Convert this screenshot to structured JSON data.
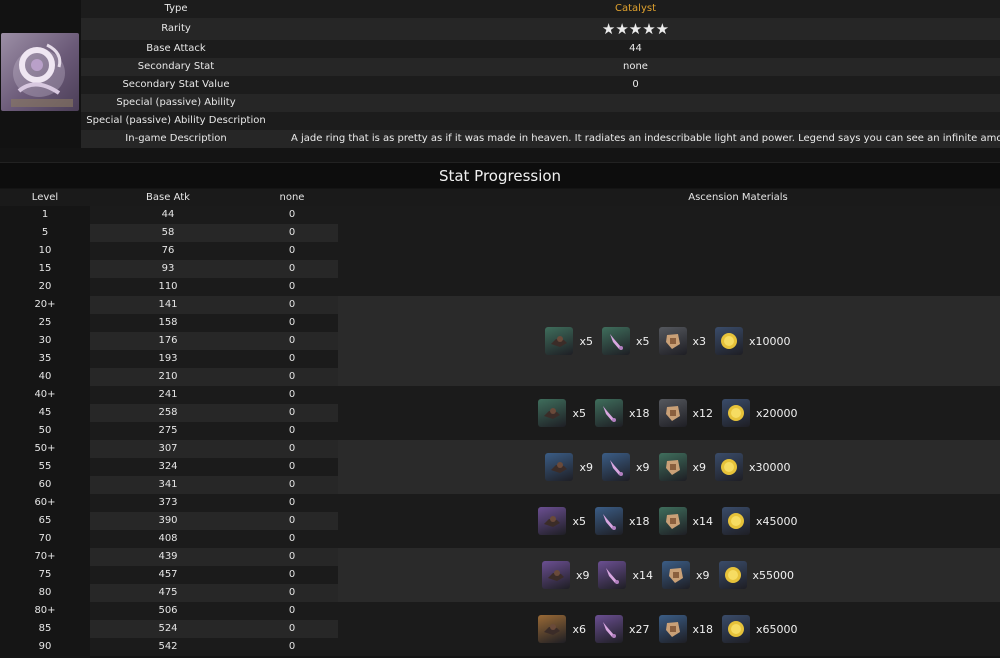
{
  "weapon": {
    "rows": [
      {
        "label": "Type",
        "value": "Catalyst"
      },
      {
        "label": "Rarity",
        "value": "★★★★★"
      },
      {
        "label": "Base Attack",
        "value": "44"
      },
      {
        "label": "Secondary Stat",
        "value": "none"
      },
      {
        "label": "Secondary Stat Value",
        "value": "0"
      },
      {
        "label": "Special (passive) Ability",
        "value": ""
      },
      {
        "label": "Special (passive) Ability Description",
        "value": ""
      },
      {
        "label": "In-game Description",
        "value": "A jade ring that is as pretty as if it was made in heaven. It radiates an indescribable light and power. Legend says you can see an infinite amou"
      }
    ]
  },
  "progression": {
    "title": "Stat Progression",
    "headers": {
      "level": "Level",
      "atk": "Base Atk",
      "sec": "none",
      "mats": "Ascension Materials"
    },
    "rows": [
      {
        "level": "1",
        "atk": "44",
        "sec": "0"
      },
      {
        "level": "5",
        "atk": "58",
        "sec": "0"
      },
      {
        "level": "10",
        "atk": "76",
        "sec": "0"
      },
      {
        "level": "15",
        "atk": "93",
        "sec": "0"
      },
      {
        "level": "20",
        "atk": "110",
        "sec": "0"
      },
      {
        "level": "20+",
        "atk": "141",
        "sec": "0"
      },
      {
        "level": "25",
        "atk": "158",
        "sec": "0"
      },
      {
        "level": "30",
        "atk": "176",
        "sec": "0"
      },
      {
        "level": "35",
        "atk": "193",
        "sec": "0"
      },
      {
        "level": "40",
        "atk": "210",
        "sec": "0"
      },
      {
        "level": "40+",
        "atk": "241",
        "sec": "0"
      },
      {
        "level": "45",
        "atk": "258",
        "sec": "0"
      },
      {
        "level": "50",
        "atk": "275",
        "sec": "0"
      },
      {
        "level": "50+",
        "atk": "307",
        "sec": "0"
      },
      {
        "level": "55",
        "atk": "324",
        "sec": "0"
      },
      {
        "level": "60",
        "atk": "341",
        "sec": "0"
      },
      {
        "level": "60+",
        "atk": "373",
        "sec": "0"
      },
      {
        "level": "65",
        "atk": "390",
        "sec": "0"
      },
      {
        "level": "70",
        "atk": "408",
        "sec": "0"
      },
      {
        "level": "70+",
        "atk": "439",
        "sec": "0"
      },
      {
        "level": "75",
        "atk": "457",
        "sec": "0"
      },
      {
        "level": "80",
        "atk": "475",
        "sec": "0"
      },
      {
        "level": "80+",
        "atk": "506",
        "sec": "0"
      },
      {
        "level": "85",
        "atk": "524",
        "sec": "0"
      },
      {
        "level": "90",
        "atk": "542",
        "sec": "0"
      }
    ],
    "ascensions": [
      {
        "materials": [
          {
            "icon": "guyun-relic-icon",
            "tier": "green",
            "count": "x5"
          },
          {
            "icon": "horn-icon",
            "tier": "green",
            "count": "x5"
          },
          {
            "icon": "insignia-icon",
            "tier": "gray",
            "count": "x3"
          },
          {
            "icon": "mora-icon",
            "tier": "mora",
            "count": "x10000"
          }
        ]
      },
      {
        "materials": [
          {
            "icon": "guyun-relic-icon",
            "tier": "green",
            "count": "x5"
          },
          {
            "icon": "horn-icon",
            "tier": "green",
            "count": "x18"
          },
          {
            "icon": "insignia-icon",
            "tier": "gray",
            "count": "x12"
          },
          {
            "icon": "mora-icon",
            "tier": "mora",
            "count": "x20000"
          }
        ]
      },
      {
        "materials": [
          {
            "icon": "guyun-relic-icon",
            "tier": "blue",
            "count": "x9"
          },
          {
            "icon": "horn-icon",
            "tier": "blue",
            "count": "x9"
          },
          {
            "icon": "insignia-icon",
            "tier": "green",
            "count": "x9"
          },
          {
            "icon": "mora-icon",
            "tier": "mora",
            "count": "x30000"
          }
        ]
      },
      {
        "materials": [
          {
            "icon": "guyun-relic-icon",
            "tier": "purple",
            "count": "x5"
          },
          {
            "icon": "horn-icon",
            "tier": "blue",
            "count": "x18"
          },
          {
            "icon": "insignia-icon",
            "tier": "green",
            "count": "x14"
          },
          {
            "icon": "mora-icon",
            "tier": "mora",
            "count": "x45000"
          }
        ]
      },
      {
        "materials": [
          {
            "icon": "guyun-relic-icon",
            "tier": "purple",
            "count": "x9"
          },
          {
            "icon": "horn-icon",
            "tier": "purple",
            "count": "x14"
          },
          {
            "icon": "insignia-icon",
            "tier": "blue",
            "count": "x9"
          },
          {
            "icon": "mora-icon",
            "tier": "mora",
            "count": "x55000"
          }
        ]
      },
      {
        "materials": [
          {
            "icon": "guyun-relic-icon",
            "tier": "gold",
            "count": "x6"
          },
          {
            "icon": "horn-icon",
            "tier": "purple",
            "count": "x27"
          },
          {
            "icon": "insignia-icon",
            "tier": "blue",
            "count": "x18"
          },
          {
            "icon": "mora-icon",
            "tier": "mora",
            "count": "x65000"
          }
        ]
      }
    ]
  },
  "colors": {
    "type_value": "#e0a22e",
    "star": "#ffe000",
    "tier_green": "#3f6e5c",
    "tier_blue": "#3b5d86",
    "tier_purple": "#6b4f92",
    "tier_gold": "#9a6a36",
    "tier_gray": "#55585e"
  }
}
